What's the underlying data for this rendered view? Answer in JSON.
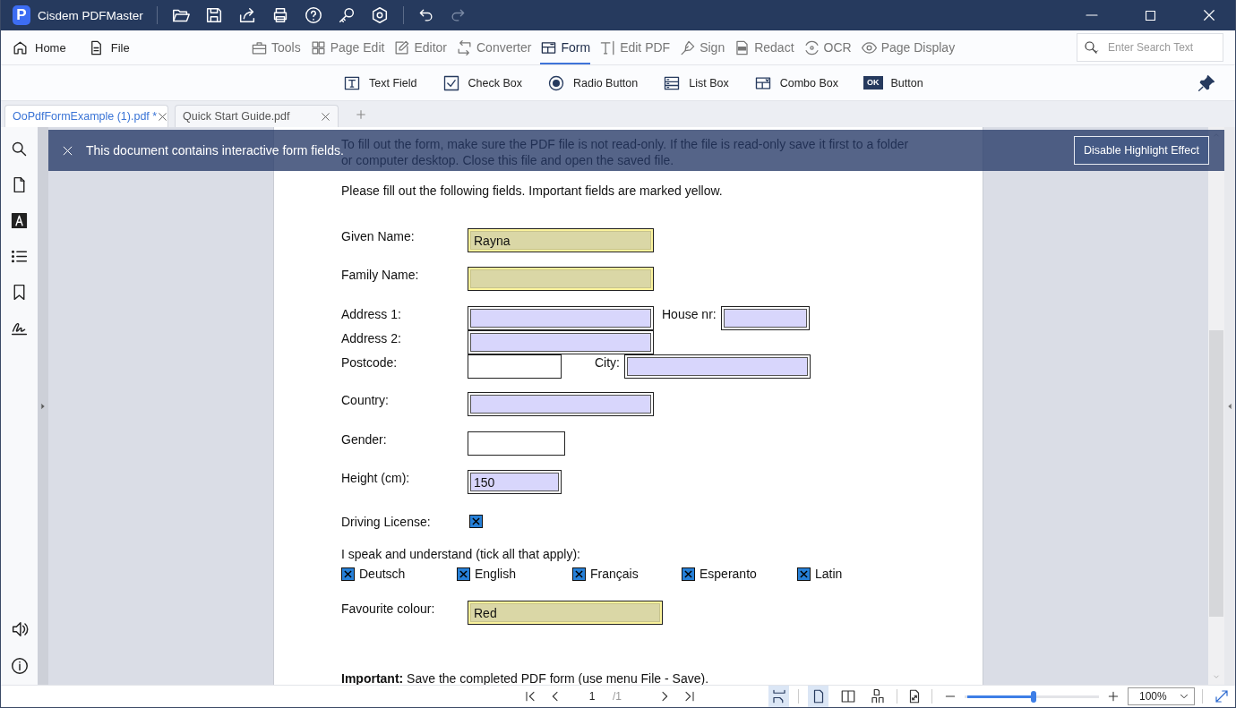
{
  "app": {
    "logo": "P",
    "name": "Cisdem PDFMaster"
  },
  "menu": {
    "left": [
      {
        "label": "Home"
      },
      {
        "label": "File"
      }
    ],
    "tools": [
      {
        "label": "Tools",
        "selected": false
      },
      {
        "label": "Page Edit",
        "selected": false
      },
      {
        "label": "Editor",
        "selected": false
      },
      {
        "label": "Converter",
        "selected": false
      },
      {
        "label": "Form",
        "selected": true
      },
      {
        "label": "Edit PDF",
        "selected": false
      },
      {
        "label": "Sign",
        "selected": false
      },
      {
        "label": "Redact",
        "selected": false
      },
      {
        "label": "OCR",
        "selected": false
      },
      {
        "label": "Page Display",
        "selected": false
      }
    ],
    "search": {
      "placeholder": "Enter Search Text"
    }
  },
  "form_tools": [
    {
      "label": "Text Field"
    },
    {
      "label": "Check Box"
    },
    {
      "label": "Radio Button"
    },
    {
      "label": "List Box"
    },
    {
      "label": "Combo Box"
    },
    {
      "label": "Button",
      "badge": "OK"
    }
  ],
  "tabs": [
    {
      "title": "OoPdfFormExample (1).pdf *",
      "selected": true
    },
    {
      "title": "Quick Start Guide.pdf",
      "selected": false
    }
  ],
  "banner": {
    "message": "This document contains interactive form fields.",
    "button": "Disable Highlight Effect"
  },
  "document": {
    "intro": "To fill out the form, make sure the PDF file is not read-only. If the file is read-only save it first to a folder or computer desktop. Close this file and open the saved file.",
    "instruction": "Please fill out the following fields. Important fields are marked yellow.",
    "rows": [
      {
        "kind": "text",
        "label": "Given Name:",
        "fields": [
          {
            "value": "Rayna",
            "important": true,
            "highlighted": true
          }
        ]
      },
      {
        "kind": "text",
        "label": "Family Name:",
        "fields": [
          {
            "important": true,
            "highlighted": true
          }
        ]
      },
      {
        "kind": "text",
        "label": "Address 1:",
        "fields": [
          {
            "important": false,
            "highlighted": true
          },
          {
            "label": "House nr:",
            "important": false,
            "highlighted": true
          }
        ]
      },
      {
        "kind": "text",
        "label": "Address 2:",
        "fields": [
          {
            "important": false,
            "highlighted": true
          }
        ]
      },
      {
        "kind": "text",
        "label": "Postcode:",
        "fields": [
          {
            "important": false,
            "highlighted": false
          },
          {
            "label": "City:",
            "important": false,
            "highlighted": true
          }
        ]
      },
      {
        "kind": "text",
        "label": "Country:",
        "fields": [
          {
            "important": false,
            "highlighted": true
          }
        ]
      },
      {
        "kind": "text",
        "label": "Gender:",
        "fields": [
          {
            "important": false,
            "highlighted": false
          }
        ]
      },
      {
        "kind": "text",
        "label": "Height (cm):",
        "fields": [
          {
            "value": "150",
            "important": false,
            "highlighted": true
          }
        ]
      },
      {
        "kind": "checkbox",
        "label": "Driving License:",
        "checked": true
      },
      {
        "kind": "choices",
        "label": "I speak and understand (tick all that apply):",
        "options": [
          {
            "label": "Deutsch",
            "checked": true
          },
          {
            "label": "English",
            "checked": true
          },
          {
            "label": "Français",
            "checked": true
          },
          {
            "label": "Esperanto",
            "checked": true
          },
          {
            "label": "Latin",
            "checked": true
          }
        ]
      },
      {
        "kind": "text",
        "label": "Favourite colour:",
        "fields": [
          {
            "value": "Red",
            "important": true,
            "highlighted": true
          }
        ]
      }
    ],
    "note": "**Important:** Save the completed PDF form (use menu File - Save)."
  },
  "status": {
    "page_current": "1",
    "page_total": "/1",
    "views": [
      {
        "selected": true
      },
      {
        "selected": true
      },
      {
        "selected": false
      },
      {
        "selected": false
      }
    ],
    "zoom": {
      "level": 0.51,
      "value": "100%"
    }
  }
}
